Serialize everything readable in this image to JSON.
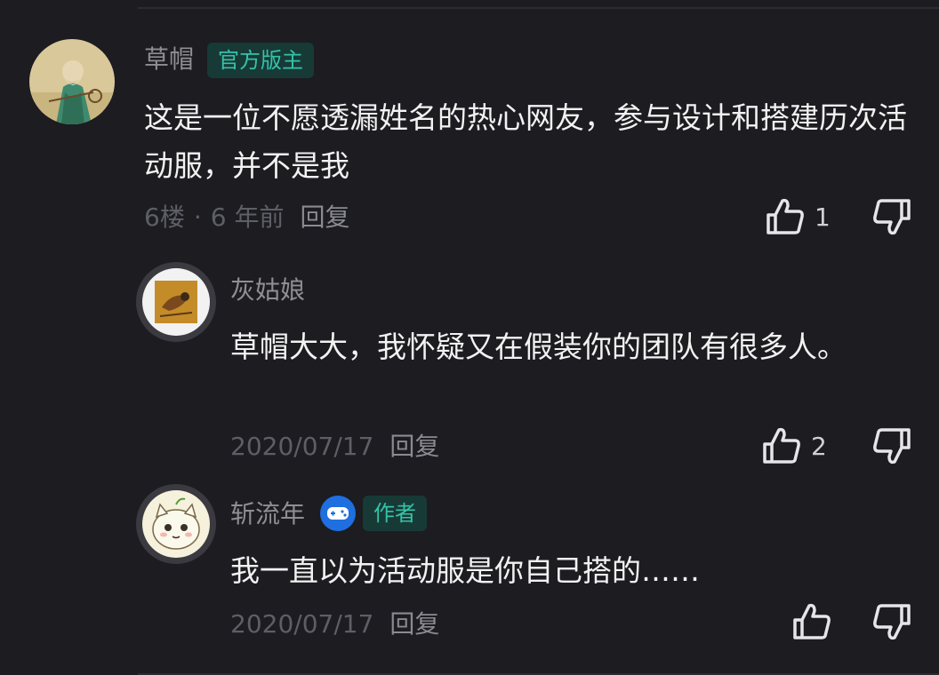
{
  "comments": [
    {
      "username": "草帽",
      "badge": "官方版主",
      "text": "这是一位不愿透漏姓名的热心网友，参与设计和搭建历次活动服，并不是我",
      "floor": "6楼",
      "time": "6 年前",
      "reply_label": "回复",
      "likes": "1",
      "avatar_icon": "old-man-painting-avatar"
    },
    {
      "username": "灰姑娘",
      "text": "草帽大大，我怀疑又在假装你的团队有很多人。",
      "time": "2020/07/17",
      "reply_label": "回复",
      "likes": "2",
      "avatar_icon": "bird-painting-avatar"
    },
    {
      "username": "斩流年",
      "badge": "作者",
      "badge_icon": "game-controller-icon",
      "text": "我一直以为活动服是你自己搭的……",
      "time": "2020/07/17",
      "reply_label": "回复",
      "likes": "",
      "avatar_icon": "cartoon-cat-avatar"
    }
  ],
  "colors": {
    "background": "#1c1c21",
    "badge_bg": "#173a37",
    "badge_text": "#35c2a8",
    "game_icon": "#1f6fe0"
  }
}
